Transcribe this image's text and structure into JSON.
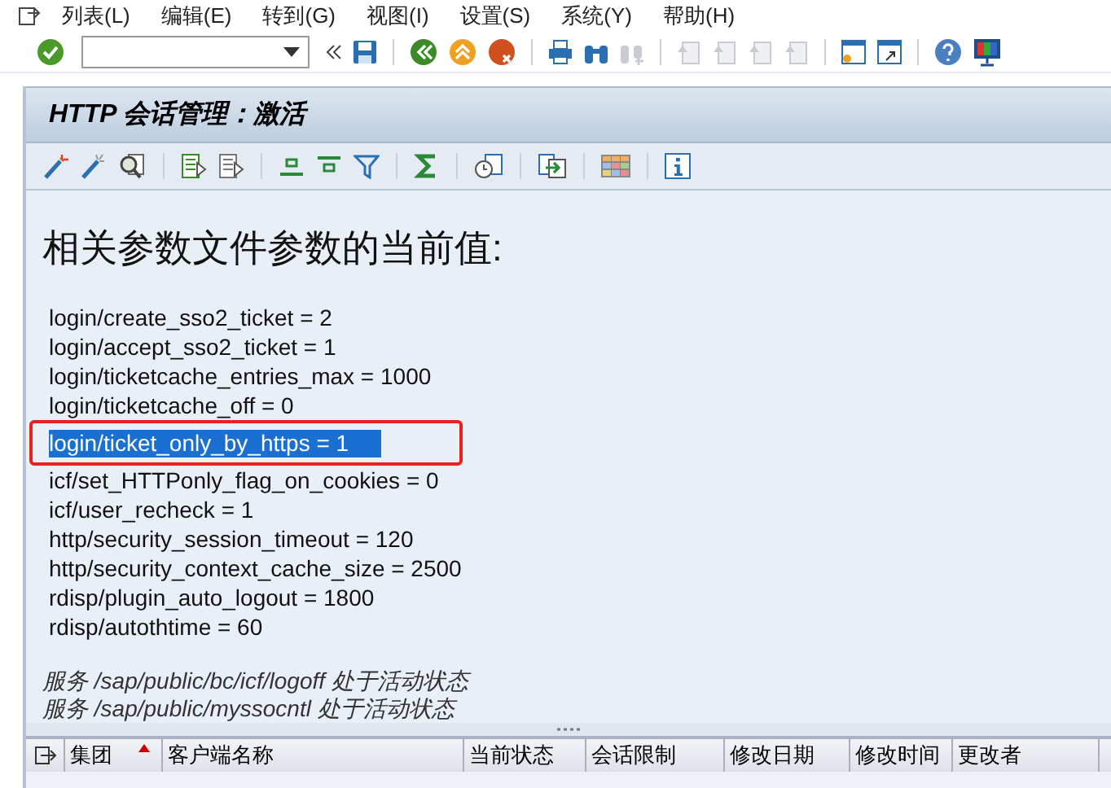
{
  "menu_bar": {
    "items": [
      "列表(L)",
      "编辑(E)",
      "转到(G)",
      "视图(I)",
      "设置(S)",
      "系统(Y)",
      "帮助(H)"
    ]
  },
  "screen_title": "HTTP 会话管理：激活",
  "heading": "相关参数文件参数的当前值:",
  "parameters": [
    {
      "text": "login/create_sso2_ticket = 2",
      "selected": false,
      "annotated": false
    },
    {
      "text": "login/accept_sso2_ticket = 1",
      "selected": false,
      "annotated": false
    },
    {
      "text": "login/ticketcache_entries_max = 1000",
      "selected": false,
      "annotated": false
    },
    {
      "text": "login/ticketcache_off = 0",
      "selected": false,
      "annotated": false
    },
    {
      "text": "login/ticket_only_by_https = 1",
      "selected": true,
      "annotated": true
    },
    {
      "text": "icf/set_HTTPonly_flag_on_cookies = 0",
      "selected": false,
      "annotated": false
    },
    {
      "text": "icf/user_recheck = 1",
      "selected": false,
      "annotated": false
    },
    {
      "text": "http/security_session_timeout = 120",
      "selected": false,
      "annotated": false
    },
    {
      "text": "http/security_context_cache_size = 2500",
      "selected": false,
      "annotated": false
    },
    {
      "text": "rdisp/plugin_auto_logout = 1800",
      "selected": false,
      "annotated": false
    },
    {
      "text": "rdisp/autothtime = 60",
      "selected": false,
      "annotated": false
    }
  ],
  "notes": [
    "服务 /sap/public/bc/icf/logoff 处于活动状态",
    "服务 /sap/public/myssocntl 处于活动状态"
  ],
  "table": {
    "columns": [
      {
        "label": "集团",
        "sorted": true
      },
      {
        "label": "客户端名称",
        "sorted": false
      },
      {
        "label": "当前状态",
        "sorted": false
      },
      {
        "label": "会话限制",
        "sorted": false
      },
      {
        "label": "修改日期",
        "sorted": false
      },
      {
        "label": "修改时间",
        "sorted": false
      },
      {
        "label": "更改者",
        "sorted": false
      }
    ]
  }
}
